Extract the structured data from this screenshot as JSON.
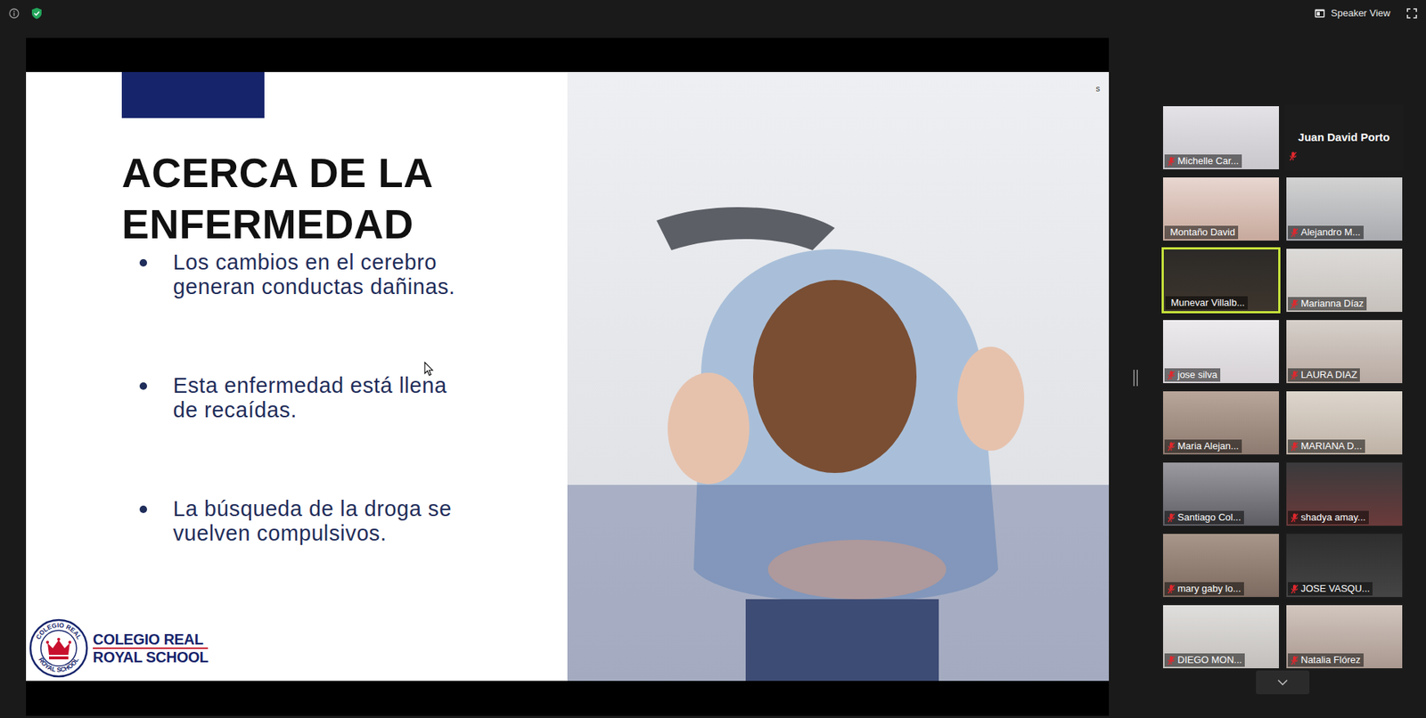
{
  "toolbar": {
    "view_label": "Speaker View"
  },
  "slide": {
    "title": "ACERCA DE LA ENFERMEDAD",
    "bullets": [
      "Los cambios en el cerebro generan conductas dañinas.",
      "Esta enfermedad está llena de recaídas.",
      "La búsqueda de la droga se vuelven compulsivos."
    ],
    "corner_mark": "s",
    "logo": {
      "ring_top": "COLEGIO REAL",
      "ring_bottom": "ROYAL SCHOOL",
      "line1": "COLEGIO REAL",
      "line2": "ROYAL SCHOOL"
    }
  },
  "participants": [
    {
      "name": "Michelle Car...",
      "video": true,
      "muted": true,
      "speaking": false
    },
    {
      "name": "Juan David Porto",
      "video": false,
      "muted": true,
      "speaking": false
    },
    {
      "name": "Montaño David",
      "video": true,
      "muted": false,
      "speaking": false
    },
    {
      "name": "Alejandro M...",
      "video": true,
      "muted": true,
      "speaking": false
    },
    {
      "name": "Munevar Villalb...",
      "video": true,
      "muted": false,
      "speaking": true
    },
    {
      "name": "Marianna Díaz",
      "video": true,
      "muted": true,
      "speaking": false
    },
    {
      "name": "jose silva",
      "video": true,
      "muted": true,
      "speaking": false
    },
    {
      "name": "LAURA DIAZ",
      "video": true,
      "muted": true,
      "speaking": false
    },
    {
      "name": "Maria Alejan...",
      "video": true,
      "muted": true,
      "speaking": false
    },
    {
      "name": "MARIANA D...",
      "video": true,
      "muted": true,
      "speaking": false
    },
    {
      "name": "Santiago Col...",
      "video": true,
      "muted": true,
      "speaking": false
    },
    {
      "name": "shadya amay...",
      "video": true,
      "muted": true,
      "speaking": false
    },
    {
      "name": "mary gaby lo...",
      "video": true,
      "muted": true,
      "speaking": false
    },
    {
      "name": "JOSE VASQU...",
      "video": true,
      "muted": true,
      "speaking": false
    },
    {
      "name": "DIEGO MON...",
      "video": true,
      "muted": true,
      "speaking": false
    },
    {
      "name": "Natalia Flórez",
      "video": true,
      "muted": true,
      "speaking": false
    }
  ]
}
